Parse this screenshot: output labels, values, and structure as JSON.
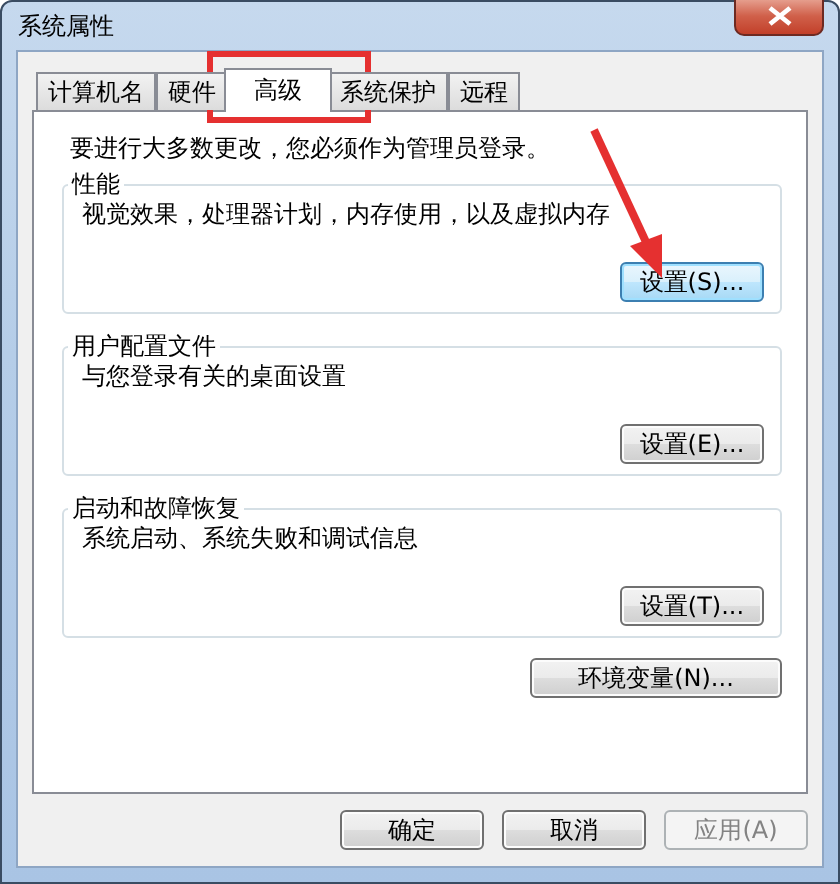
{
  "window": {
    "title": "系统属性"
  },
  "tabs": [
    {
      "label": "计算机名",
      "selected": false
    },
    {
      "label": "硬件",
      "selected": false
    },
    {
      "label": "高级",
      "selected": true
    },
    {
      "label": "系统保护",
      "selected": false
    },
    {
      "label": "远程",
      "selected": false
    }
  ],
  "notice": "要进行大多数更改，您必须作为管理员登录。",
  "groups": [
    {
      "title": "性能",
      "description": "视觉效果，处理器计划，内存使用，以及虚拟内存",
      "button": "设置(S)...",
      "focused": true
    },
    {
      "title": "用户配置文件",
      "description": "与您登录有关的桌面设置",
      "button": "设置(E)...",
      "focused": false
    },
    {
      "title": "启动和故障恢复",
      "description": "系统启动、系统失败和调试信息",
      "button": "设置(T)...",
      "focused": false
    }
  ],
  "env_button": "环境变量(N)...",
  "buttons": [
    {
      "label": "确定",
      "disabled": false
    },
    {
      "label": "取消",
      "disabled": false
    },
    {
      "label": "应用(A)",
      "disabled": true
    }
  ]
}
